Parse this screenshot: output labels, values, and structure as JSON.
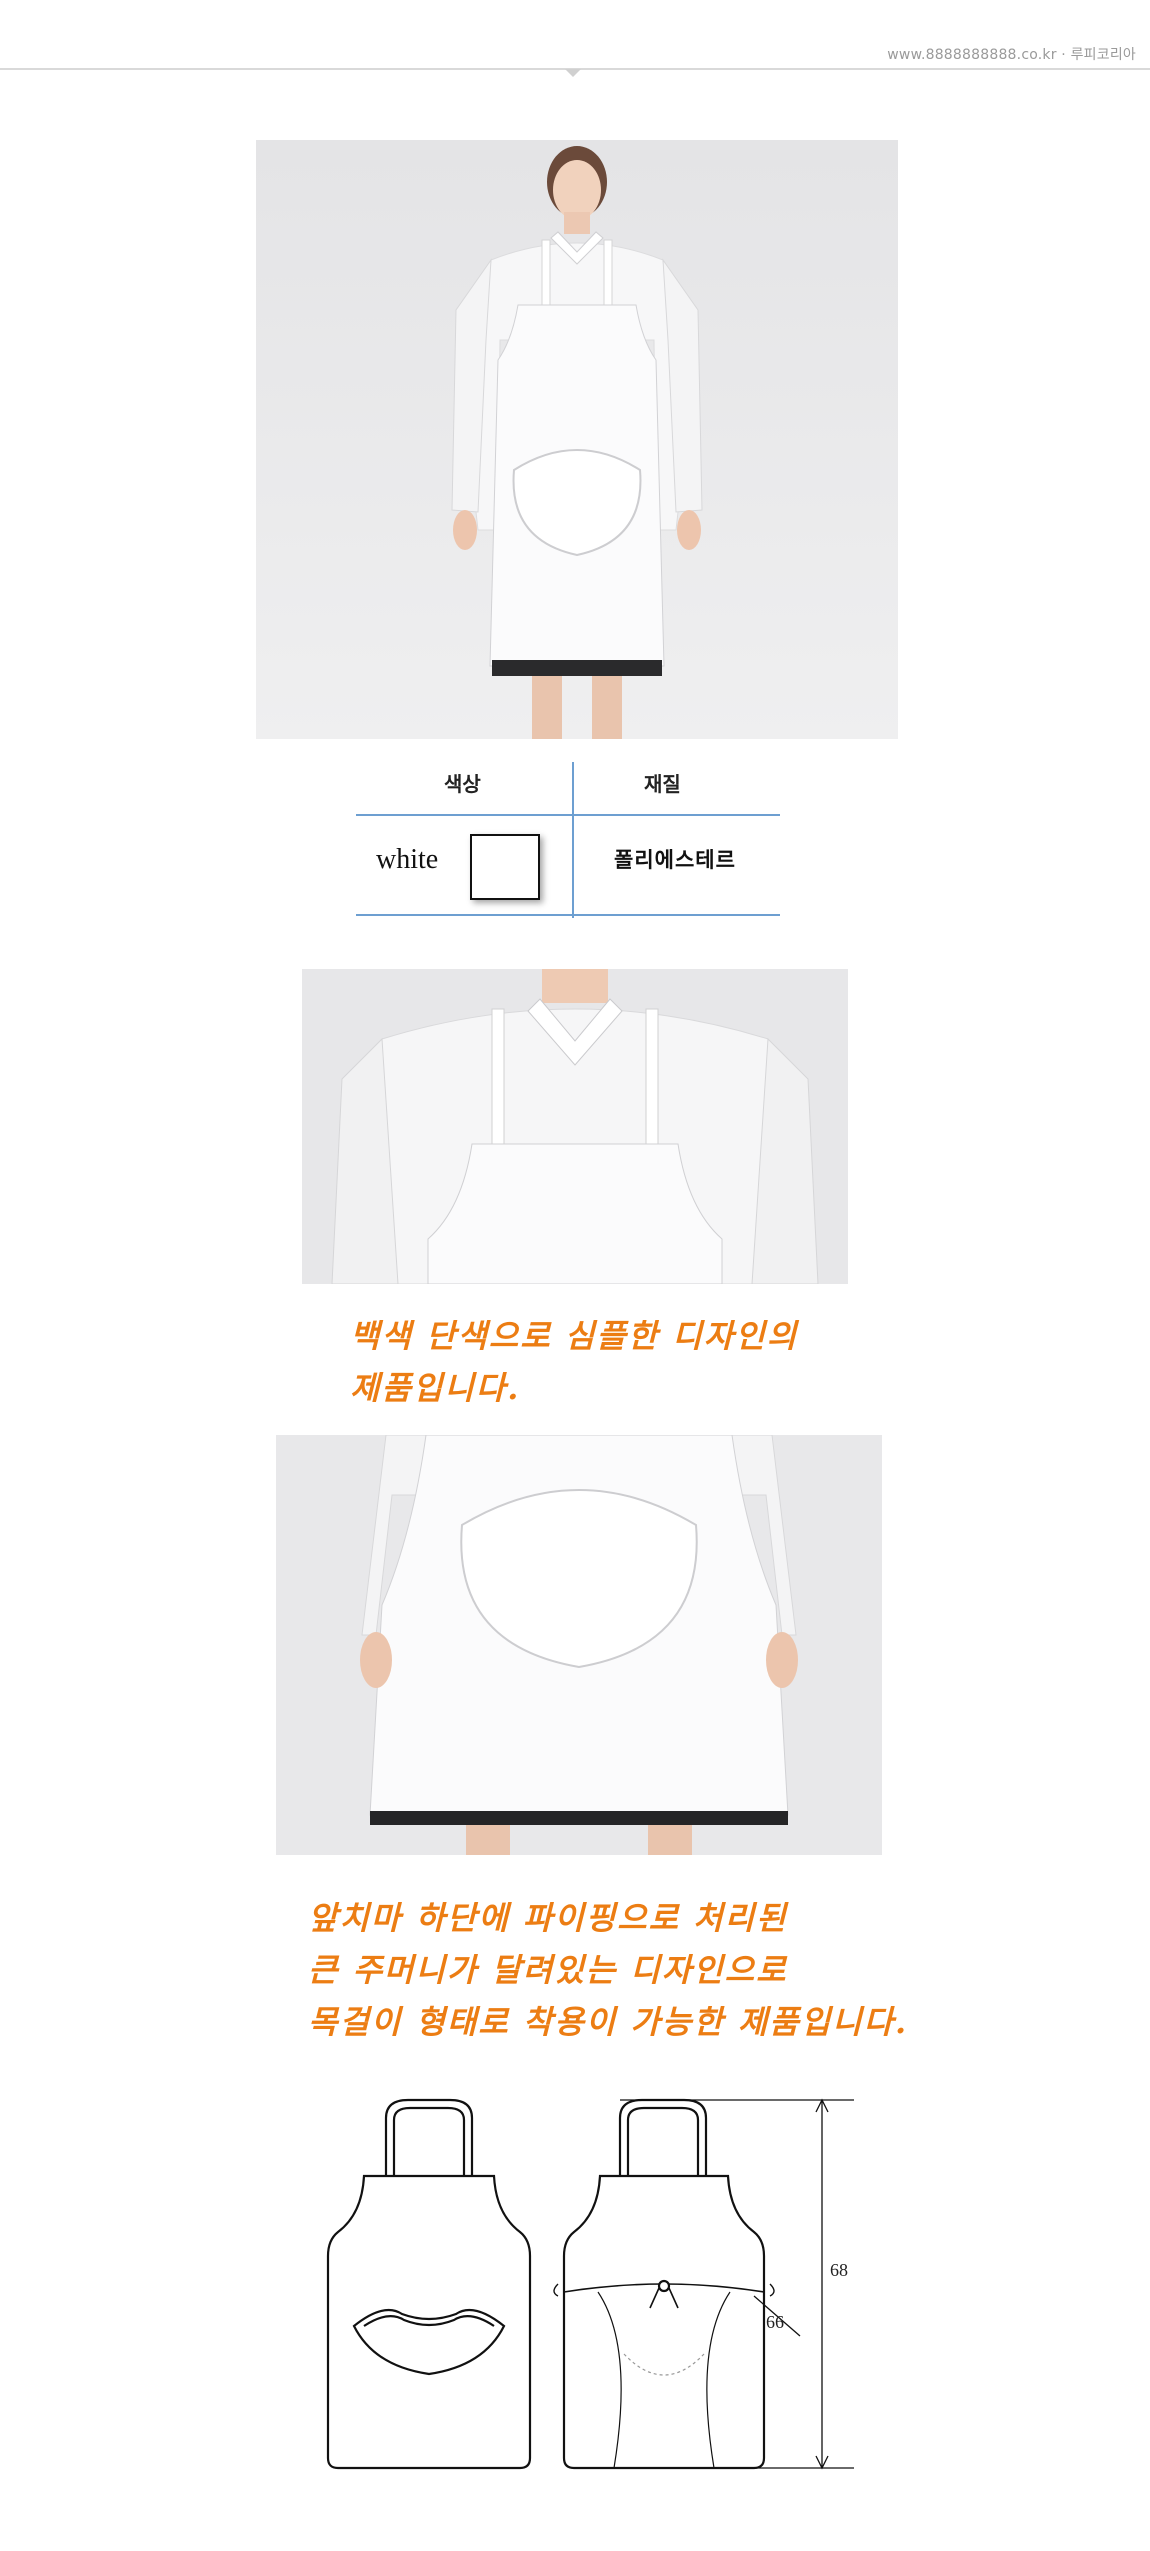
{
  "header": {
    "site_text": "www.8888888888.co.kr · 루피코리아"
  },
  "spec_table": {
    "color_header": "색상",
    "material_header": "재질",
    "color_value": "white",
    "material_value": "폴리에스테르",
    "swatch_color": "#ffffff"
  },
  "captions": {
    "first": [
      "백색 단색으로 심플한 디자인의",
      "제품입니다."
    ],
    "second": [
      "앞치마 하단에 파이핑으로 처리된",
      "큰 주머니가 달려있는 디자인으로",
      "목걸이 형태로 착용이 가능한 제품입니다."
    ]
  },
  "diagram": {
    "length_label": "68",
    "width_label": "66"
  },
  "colors": {
    "caption_orange": "#ec7d13",
    "table_rule_blue": "#6d9fd1"
  }
}
